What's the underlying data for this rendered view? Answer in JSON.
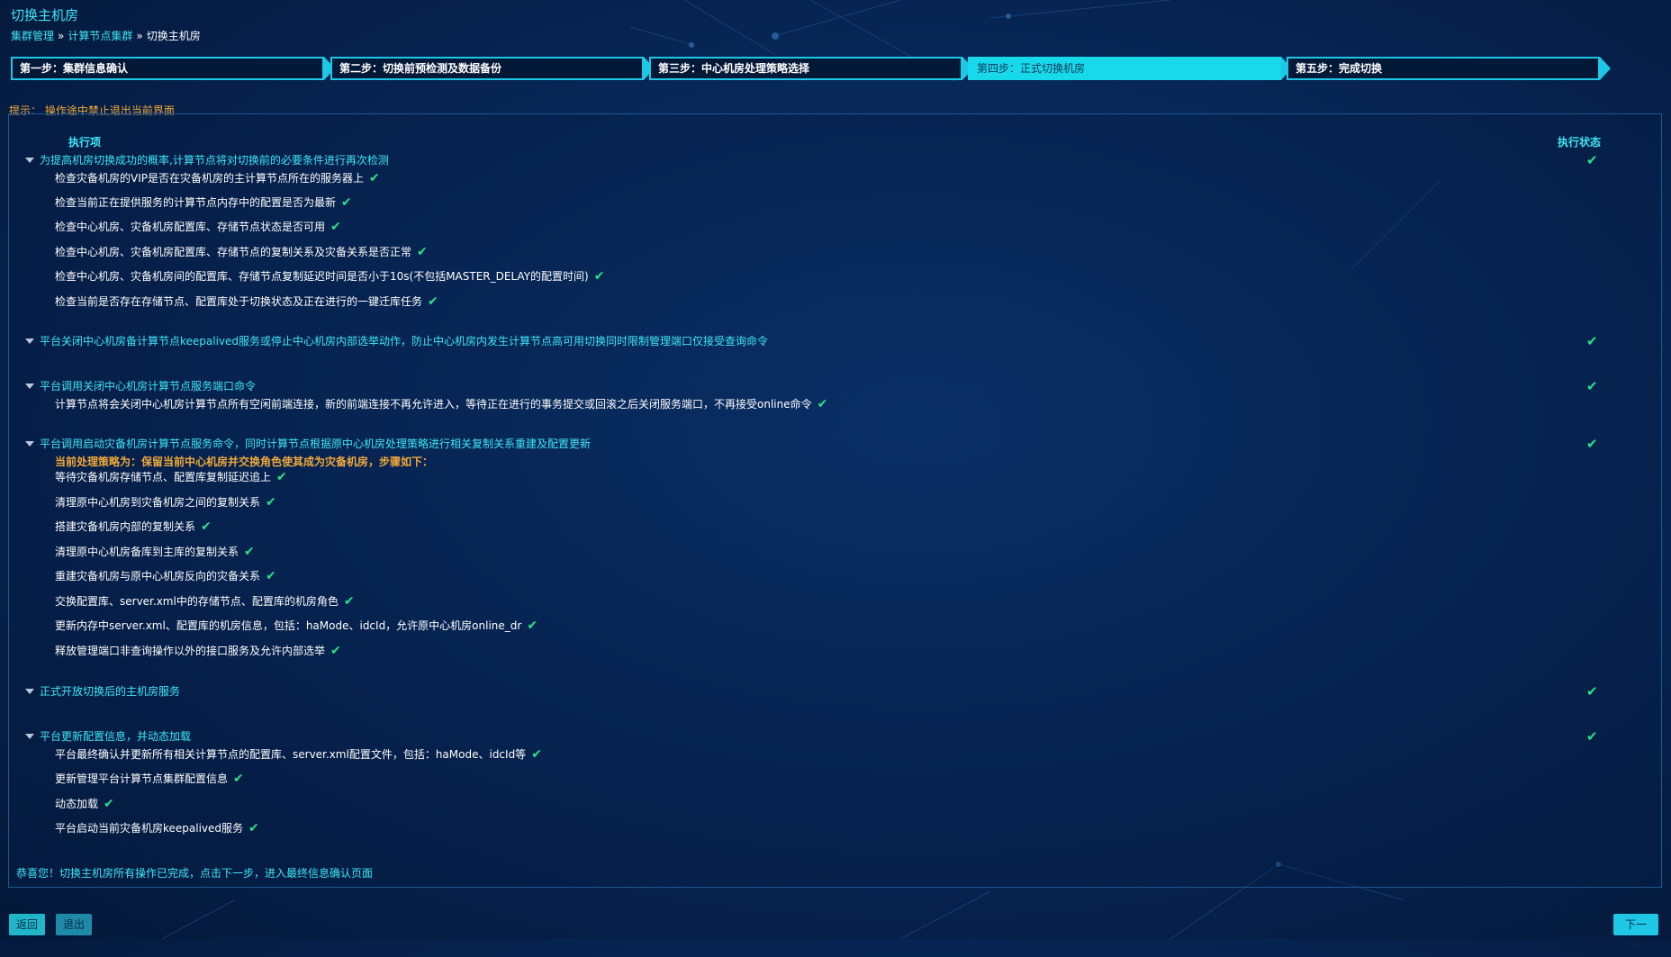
{
  "header": {
    "title": "切换主机房",
    "breadcrumb": [
      "集群管理",
      "计算节点集群",
      "切换主机房"
    ],
    "separator": "»"
  },
  "steps": [
    {
      "label": "第一步：集群信息确认",
      "active": false
    },
    {
      "label": "第二步：切换前预检测及数据备份",
      "active": false
    },
    {
      "label": "第三步：中心机房处理策略选择",
      "active": false
    },
    {
      "label": "第四步：正式切换机房",
      "active": true
    },
    {
      "label": "第五步：完成切换",
      "active": false
    }
  ],
  "tip": "提示：  操作途中禁止退出当前界面",
  "table": {
    "col_item": "执行项",
    "col_status": "执行状态"
  },
  "groups": [
    {
      "title": "为提高机房切换成功的概率,计算节点将对切换前的必要条件进行再次检测",
      "items": [
        "检查灾备机房的VIP是否在灾备机房的主计算节点所在的服务器上",
        "检查当前正在提供服务的计算节点内存中的配置是否为最新",
        "检查中心机房、灾备机房配置库、存储节点状态是否可用",
        "检查中心机房、灾备机房配置库、存储节点的复制关系及灾备关系是否正常",
        "检查中心机房、灾备机房间的配置库、存储节点复制延迟时间是否小于10s(不包括MASTER_DELAY的配置时间)",
        "检查当前是否存在存储节点、配置库处于切换状态及正在进行的一键迁库任务"
      ]
    },
    {
      "title": "平台关闭中心机房备计算节点keepalived服务或停止中心机房内部选举动作，防止中心机房内发生计算节点高可用切换同时限制管理端口仅接受查询命令",
      "items": []
    },
    {
      "title": "平台调用关闭中心机房计算节点服务端口命令",
      "items": [
        "计算节点将会关闭中心机房计算节点所有空闲前端连接，新的前端连接不再允许进入，等待正在进行的事务提交或回滚之后关闭服务端口，不再接受online命令"
      ]
    },
    {
      "title": "平台调用启动灾备机房计算节点服务命令，同时计算节点根据原中心机房处理策略进行相关复制关系重建及配置更新",
      "policy": "当前处理策略为：保留当前中心机房并交换角色使其成为灾备机房，步骤如下：",
      "items": [
        "等待灾备机房存储节点、配置库复制延迟追上",
        "清理原中心机房到灾备机房之间的复制关系",
        "搭建灾备机房内部的复制关系",
        "清理原中心机房备库到主库的复制关系",
        "重建灾备机房与原中心机房反向的灾备关系",
        "交换配置库、server.xml中的存储节点、配置库的机房角色",
        "更新内存中server.xml、配置库的机房信息，包括：haMode、idcId，允许原中心机房online_dr",
        "释放管理端口非查询操作以外的接口服务及允许内部选举"
      ]
    },
    {
      "title": "正式开放切换后的主机房服务",
      "items": []
    },
    {
      "title": "平台更新配置信息，并动态加载",
      "items": [
        "平台最终确认并更新所有相关计算节点的配置库、server.xml配置文件，包括：haMode、idcId等",
        "更新管理平台计算节点集群配置信息",
        "动态加载",
        "平台启动当前灾备机房keepalived服务"
      ]
    }
  ],
  "footer_message": "恭喜您！切换主机房所有操作已完成，点击下一步，进入最终信息确认页面",
  "buttons": {
    "back": "返回",
    "exit": "退出",
    "next": "下一步"
  },
  "colors": {
    "accent": "#1ec7e6",
    "check": "#2be08a",
    "warning": "#f0a93a",
    "background": "#06204a"
  }
}
